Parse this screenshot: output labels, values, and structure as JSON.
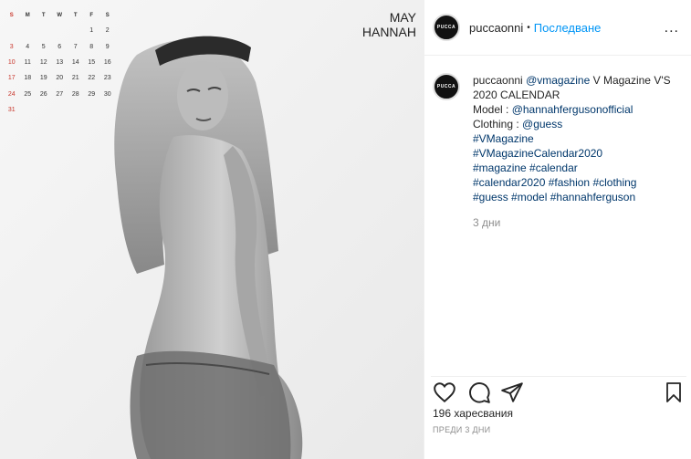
{
  "photo": {
    "month": "MAY",
    "model_name": "HANNAH",
    "calendar": {
      "headers": [
        "S",
        "M",
        "T",
        "W",
        "T",
        "F",
        "S"
      ],
      "weeks": [
        [
          "",
          "",
          "",
          "",
          "",
          "1",
          "2"
        ],
        [
          "3",
          "4",
          "5",
          "6",
          "7",
          "8",
          "9"
        ],
        [
          "10",
          "11",
          "12",
          "13",
          "14",
          "15",
          "16"
        ],
        [
          "17",
          "18",
          "19",
          "20",
          "21",
          "22",
          "23"
        ],
        [
          "24",
          "25",
          "26",
          "27",
          "28",
          "29",
          "30"
        ],
        [
          "31",
          "",
          "",
          "",
          "",
          "",
          ""
        ]
      ]
    }
  },
  "header": {
    "avatar_text": "PUCCA",
    "username": "puccaonni",
    "separator": "•",
    "follow_label": "Последване",
    "more_label": "..."
  },
  "caption": {
    "avatar_text": "PUCCA",
    "username": "puccaonni",
    "line1_mention": "@vmagazine",
    "line1_rest": " V Magazine V'S 2020 CALENDAR",
    "model_label": "Model : ",
    "model_mention": "@hannahfergusonofficial",
    "clothing_label": "Clothing : ",
    "clothing_mention": "@guess",
    "hashtags": [
      "#VMagazine",
      "#VMagazineCalendar2020",
      "#magazine #calendar",
      "#calendar2020 #fashion #clothing",
      "#guess #model #hannahferguson"
    ],
    "time": "3 дни"
  },
  "footer": {
    "likes": "196 харесвания",
    "posted_ago": "ПРЕДИ 3 ДНИ"
  },
  "colors": {
    "accent": "#0095f6",
    "link": "#00376b",
    "muted": "#8e8e8e",
    "calendar_sunday": "#c8352a"
  }
}
